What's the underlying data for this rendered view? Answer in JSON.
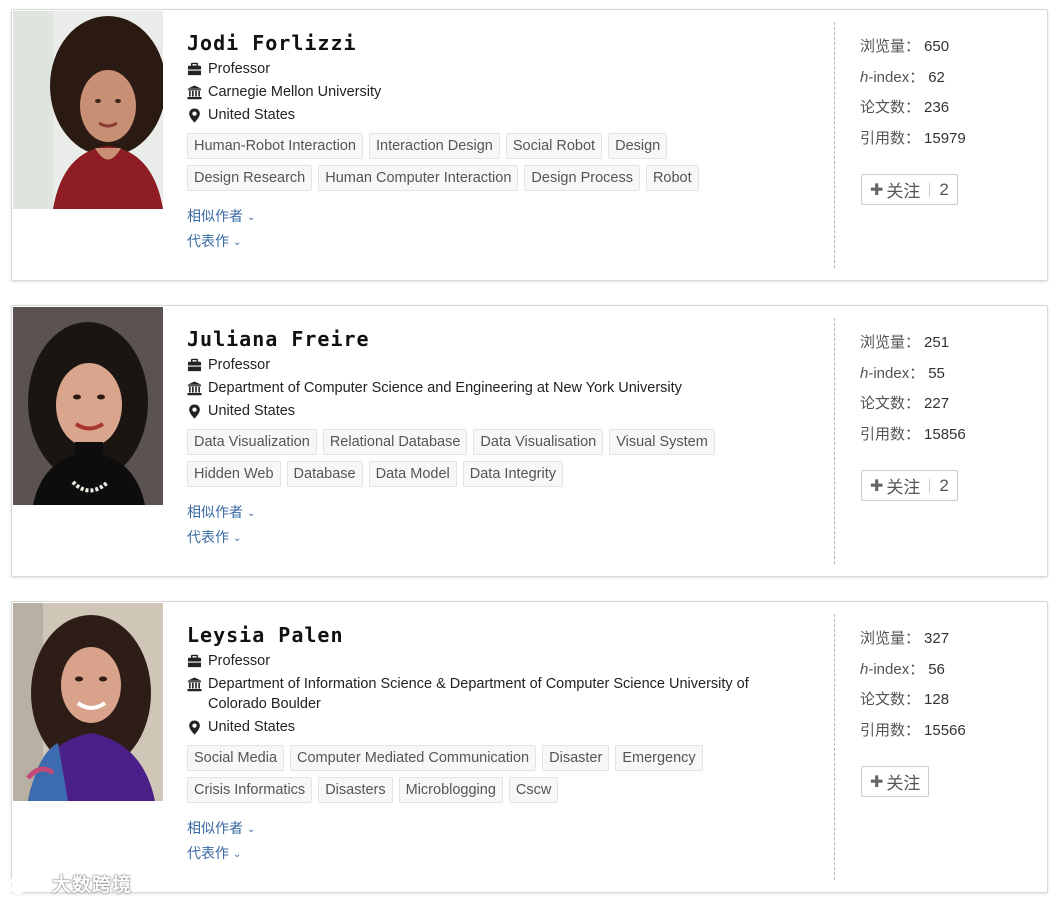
{
  "scholars": [
    {
      "name": "Jodi Forlizzi",
      "title": "Professor",
      "affiliation": "Carnegie Mellon University",
      "location": "United States",
      "tags": [
        "Human-Robot Interaction",
        "Interaction Design",
        "Social Robot",
        "Design",
        "Design Research",
        "Human Computer Interaction",
        "Design Process",
        "Robot"
      ],
      "similar_label": "相似作者",
      "works_label": "代表作",
      "stats": {
        "views_label": "浏览量：",
        "views": "650",
        "hindex_prefix": "h",
        "hindex_label": "-index：",
        "hindex": "62",
        "papers_label": "论文数：",
        "papers": "236",
        "citations_label": "引用数：",
        "citations": "15979"
      },
      "follow_label": "关注",
      "follow_count": "2"
    },
    {
      "name": "Juliana Freire",
      "title": "Professor",
      "affiliation": "Department of Computer Science and Engineering at New York University",
      "location": "United States",
      "tags": [
        "Data Visualization",
        "Relational Database",
        "Data Visualisation",
        "Visual System",
        "Hidden Web",
        "Database",
        "Data Model",
        "Data Integrity"
      ],
      "similar_label": "相似作者",
      "works_label": "代表作",
      "stats": {
        "views_label": "浏览量：",
        "views": "251",
        "hindex_prefix": "h",
        "hindex_label": "-index：",
        "hindex": "55",
        "papers_label": "论文数：",
        "papers": "227",
        "citations_label": "引用数：",
        "citations": "15856"
      },
      "follow_label": "关注",
      "follow_count": "2"
    },
    {
      "name": "Leysia Palen",
      "title": "Professor",
      "affiliation": "Department of Information Science & Department of Computer Science University of Colorado Boulder",
      "location": "United States",
      "tags": [
        "Social Media",
        "Computer Mediated Communication",
        "Disaster",
        "Emergency",
        "Crisis Informatics",
        "Disasters",
        "Microblogging",
        "Cscw"
      ],
      "similar_label": "相似作者",
      "works_label": "代表作",
      "stats": {
        "views_label": "浏览量：",
        "views": "327",
        "hindex_prefix": "h",
        "hindex_label": "-index：",
        "hindex": "56",
        "papers_label": "论文数：",
        "papers": "128",
        "citations_label": "引用数：",
        "citations": "15566"
      },
      "follow_label": "关注",
      "follow_count": ""
    }
  ],
  "watermark": "大数跨境",
  "icons": {
    "title": "briefcase-icon",
    "affiliation": "institution-icon",
    "location": "map-pin-icon",
    "follow": "plus-icon",
    "expand": "chevron-down-icon"
  },
  "colors": {
    "link": "#3a6aa3",
    "tag_bg": "#f7f7f7",
    "tag_border": "#e3e3e3",
    "card_border": "#d9d9d9"
  }
}
